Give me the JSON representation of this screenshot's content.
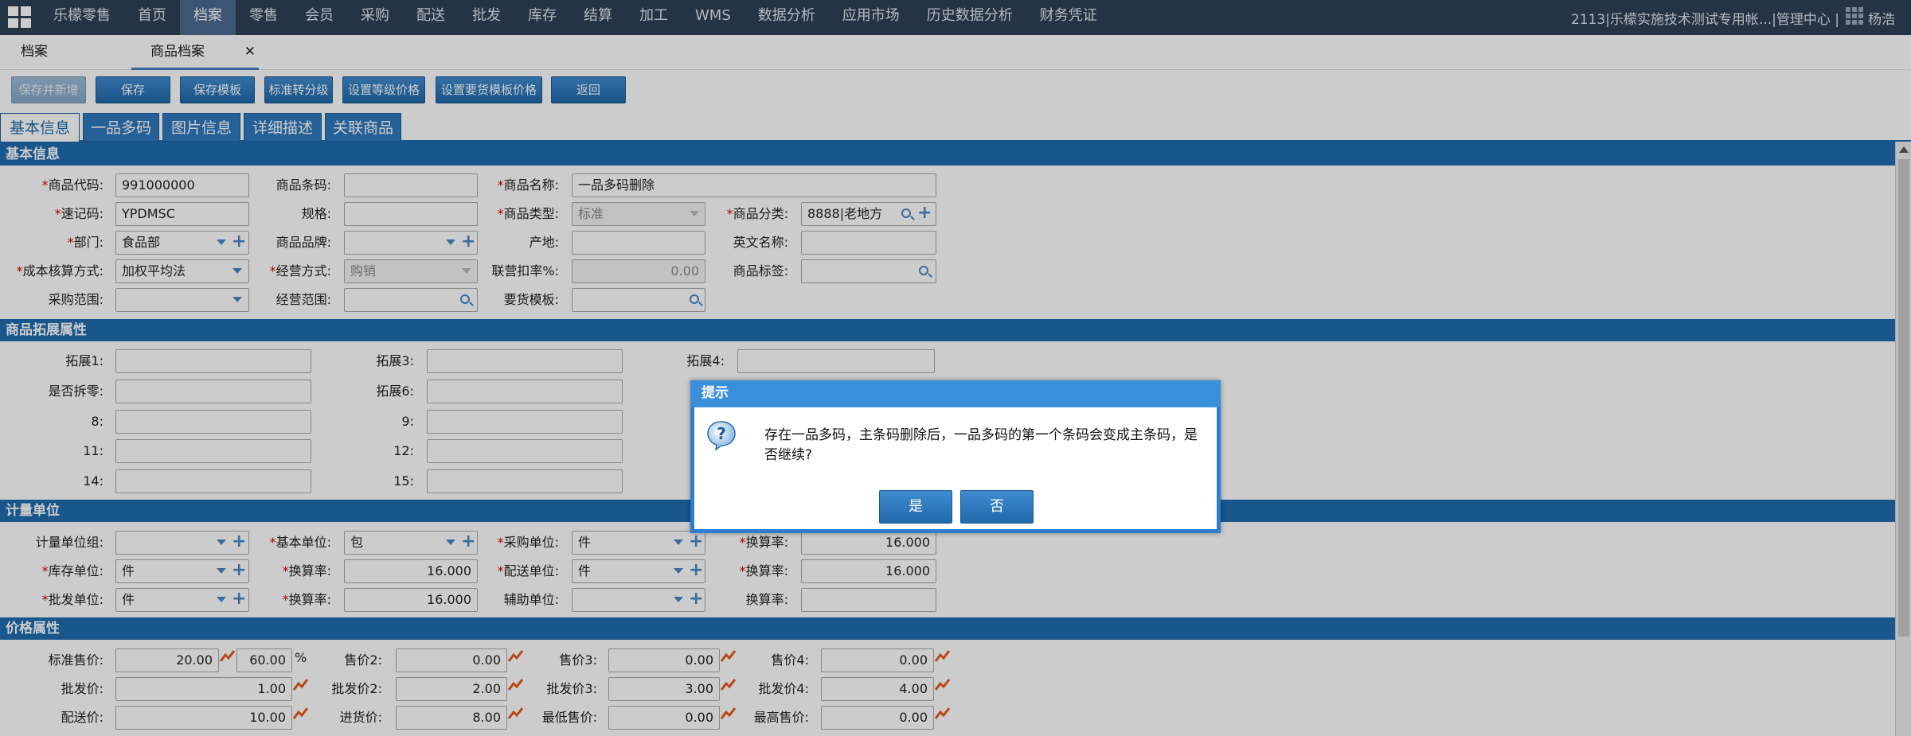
{
  "topnav": {
    "items": [
      "乐檬零售",
      "首页",
      "档案",
      "零售",
      "会员",
      "采购",
      "配送",
      "批发",
      "库存",
      "结算",
      "加工",
      "WMS",
      "数据分析",
      "应用市场",
      "历史数据分析",
      "财务凭证"
    ],
    "right_text": "2113|乐檬实施技术测试专用帐...|管理中心 |",
    "user": "杨浩"
  },
  "page_tabs": [
    "档案",
    "商品档案"
  ],
  "toolbar": [
    "保存并新增",
    "保存",
    "保存模板",
    "标准转分级",
    "设置等级价格",
    "设置要货模板价格",
    "返回"
  ],
  "form_tabs": [
    "基本信息",
    "一品多码",
    "图片信息",
    "详细描述",
    "关联商品"
  ],
  "sections": {
    "basic": "基本信息",
    "ext": "商品拓展属性",
    "unit": "计量单位",
    "price": "价格属性"
  },
  "basic": {
    "code": {
      "label": "商品代码:",
      "value": "991000000"
    },
    "barcode": {
      "label": "商品条码:",
      "value": ""
    },
    "name": {
      "label": "商品名称:",
      "value": "一品多码删除"
    },
    "quick": {
      "label": "速记码:",
      "value": "YPDMSC"
    },
    "spec": {
      "label": "规格:",
      "value": ""
    },
    "type": {
      "label": "商品类型:",
      "value": "标准"
    },
    "category": {
      "label": "商品分类:",
      "value": "8888|老地方"
    },
    "dept": {
      "label": "部门:",
      "value": "食品部"
    },
    "brand": {
      "label": "商品品牌:",
      "value": ""
    },
    "origin": {
      "label": "产地:",
      "value": ""
    },
    "en_name": {
      "label": "英文名称:",
      "value": ""
    },
    "cost": {
      "label": "成本核算方式:",
      "value": "加权平均法"
    },
    "biz_mode": {
      "label": "经营方式:",
      "value": "购销"
    },
    "rate": {
      "label": "联营扣率%:",
      "value": "0.00"
    },
    "tag": {
      "label": "商品标签:",
      "value": ""
    },
    "purchase_range": {
      "label": "采购范围:",
      "value": ""
    },
    "biz_range": {
      "label": "经营范围:",
      "value": ""
    },
    "order_tpl": {
      "label": "要货模板:",
      "value": ""
    }
  },
  "ext": {
    "labels": [
      "拓展1:",
      "拓展3:",
      "拓展4:",
      "是否拆零:",
      "拓展6:",
      "8:",
      "9:",
      "11:",
      "12:",
      "14:",
      "15:"
    ]
  },
  "unit": {
    "group": {
      "label": "计量单位组:",
      "value": ""
    },
    "base": {
      "label": "基本单位:",
      "value": "包"
    },
    "purchase": {
      "label": "采购单位:",
      "value": "件"
    },
    "conv1": {
      "label": "换算率:",
      "value": "16.000"
    },
    "stock": {
      "label": "库存单位:",
      "value": "件"
    },
    "conv2": {
      "label": "换算率:",
      "value": "16.000"
    },
    "delivery": {
      "label": "配送单位:",
      "value": "件"
    },
    "conv3": {
      "label": "换算率:",
      "value": "16.000"
    },
    "wholesale": {
      "label": "批发单位:",
      "value": "件"
    },
    "conv4": {
      "label": "换算率:",
      "value": "16.000"
    },
    "aux": {
      "label": "辅助单位:",
      "value": ""
    },
    "conv5": {
      "label": "换算率:",
      "value": ""
    }
  },
  "price": {
    "std": {
      "label": "标准售价:",
      "value": "20.00",
      "pct": "60.00",
      "pct_sign": "%"
    },
    "p2": {
      "label": "售价2:",
      "value": "0.00"
    },
    "p3": {
      "label": "售价3:",
      "value": "0.00"
    },
    "p4": {
      "label": "售价4:",
      "value": "0.00"
    },
    "w1": {
      "label": "批发价:",
      "value": "1.00"
    },
    "w2": {
      "label": "批发价2:",
      "value": "2.00"
    },
    "w3": {
      "label": "批发价3:",
      "value": "3.00"
    },
    "w4": {
      "label": "批发价4:",
      "value": "4.00"
    },
    "dlv": {
      "label": "配送价:",
      "value": "10.00"
    },
    "in": {
      "label": "进货价:",
      "value": "8.00"
    },
    "min": {
      "label": "最低售价:",
      "value": "0.00"
    },
    "max": {
      "label": "最高售价:",
      "value": "0.00"
    }
  },
  "dialog": {
    "title": "提示",
    "message": "存在一品多码，主条码删除后，一品多码的第一个条码会变成主条码，是否继续?",
    "yes": "是",
    "no": "否"
  }
}
